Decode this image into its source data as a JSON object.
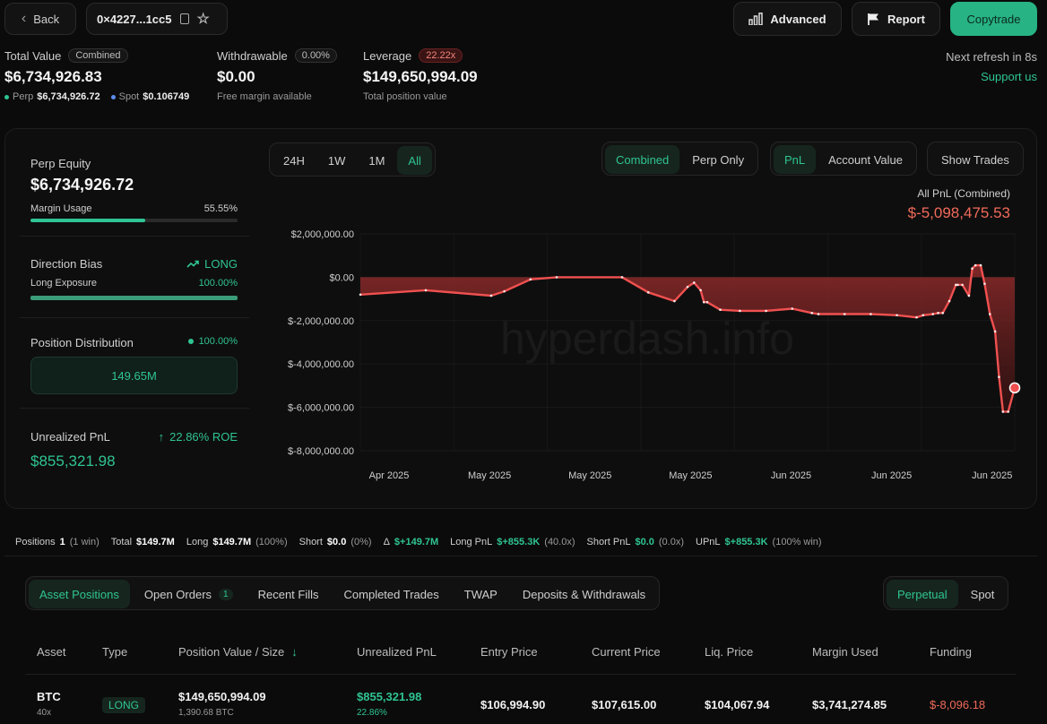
{
  "nav": {
    "back_label": "Back",
    "address": "0×4227...1cc5"
  },
  "actions": {
    "advanced": "Advanced",
    "report": "Report",
    "copytrade": "Copytrade"
  },
  "refresh": {
    "text": "Next refresh in 8s",
    "support": "Support us"
  },
  "summary": {
    "total_value_label": "Total Value",
    "total_value_badge": "Combined",
    "total_value": "$6,734,926.83",
    "perp_label": "Perp",
    "perp_value": "$6,734,926.72",
    "spot_label": "Spot",
    "spot_value": "$0.106749",
    "withdrawable_label": "Withdrawable",
    "withdrawable_badge": "0.00%",
    "withdrawable_value": "$0.00",
    "withdrawable_sub": "Free margin available",
    "leverage_label": "Leverage",
    "leverage_badge": "22.22x",
    "leverage_value": "$149,650,994.09",
    "leverage_sub": "Total position value"
  },
  "side": {
    "perp_equity_label": "Perp Equity",
    "perp_equity_value": "$6,734,926.72",
    "margin_usage_label": "Margin Usage",
    "margin_usage_value": "55.55%",
    "margin_usage_fraction": 0.5555,
    "direction_label": "Direction Bias",
    "direction_value": "LONG",
    "long_exposure_label": "Long Exposure",
    "long_exposure_value": "100.00%",
    "long_exposure_fraction": 1.0,
    "distribution_label": "Position Distribution",
    "distribution_value": "100.00%",
    "distribution_amount": "149.65M",
    "upnl_label": "Unrealized PnL",
    "upnl_roe": "22.86% ROE",
    "upnl_value": "$855,321.98"
  },
  "chart_controls": {
    "ranges": [
      "24H",
      "1W",
      "1M",
      "All"
    ],
    "active_range": "All",
    "modes": [
      "Combined",
      "Perp Only"
    ],
    "active_mode": "Combined",
    "metrics": [
      "PnL",
      "Account Value"
    ],
    "active_metric": "PnL",
    "show_trades": "Show Trades"
  },
  "chart_data": {
    "type": "area",
    "title": "All PnL (Combined)",
    "headline": "$-5,098,475.53",
    "watermark": "hyperdash.info",
    "x_tick_labels": [
      "Apr 2025",
      "May 2025",
      "May 2025",
      "May 2025",
      "Jun 2025",
      "Jun 2025",
      "Jun 2025"
    ],
    "y_tick_labels": [
      "$2,000,000.00",
      "$0.00",
      "$-2,000,000.00",
      "$-4,000,000.00",
      "$-6,000,000.00",
      "$-8,000,000.00"
    ],
    "y_ticks": [
      2000000,
      0,
      -2000000,
      -4000000,
      -6000000,
      -8000000
    ],
    "ylim": [
      -8000000,
      2000000
    ],
    "x_range": [
      0,
      100
    ],
    "series": [
      {
        "color": "#f05050",
        "x": [
          0,
          10,
          20,
          22,
          26,
          30,
          40,
          44,
          48,
          50,
          51,
          52,
          52.5,
          53,
          55,
          58,
          62,
          66,
          69,
          70,
          74,
          78,
          82,
          85,
          86,
          87.5,
          88.3,
          89,
          90,
          91,
          91.3,
          92,
          93,
          93.5,
          94,
          94.8,
          95.4,
          96.2,
          97,
          97.6,
          98.2,
          99,
          100
        ],
        "y": [
          -800000,
          -600000,
          -850000,
          -650000,
          -100000,
          0,
          0,
          -700000,
          -1100000,
          -450000,
          -250000,
          -600000,
          -1150000,
          -1150000,
          -1500000,
          -1550000,
          -1550000,
          -1450000,
          -1650000,
          -1700000,
          -1700000,
          -1700000,
          -1750000,
          -1850000,
          -1750000,
          -1700000,
          -1650000,
          -1650000,
          -1100000,
          -350000,
          -350000,
          -350000,
          -850000,
          400000,
          550000,
          550000,
          -300000,
          -1700000,
          -2500000,
          -4600000,
          -6200000,
          -6200000,
          -5100000
        ]
      }
    ]
  },
  "stats": {
    "positions_label": "Positions",
    "positions_count": "1",
    "positions_wins": "(1 win)",
    "total_label": "Total",
    "total_value": "$149.7M",
    "long_label": "Long",
    "long_value": "$149.7M",
    "long_pct": "(100%)",
    "short_label": "Short",
    "short_value": "$0.0",
    "short_pct": "(0%)",
    "delta_label": "Δ",
    "delta_value": "$+149.7M",
    "long_pnl_label": "Long PnL",
    "long_pnl_value": "$+855.3K",
    "long_pnl_mult": "(40.0x)",
    "short_pnl_label": "Short PnL",
    "short_pnl_value": "$0.0",
    "short_pnl_mult": "(0.0x)",
    "upnl_label": "UPnL",
    "upnl_value": "$+855.3K",
    "upnl_note": "(100% win)"
  },
  "tabs": {
    "items": [
      "Asset Positions",
      "Open Orders",
      "Recent Fills",
      "Completed Trades",
      "TWAP",
      "Deposits & Withdrawals"
    ],
    "open_orders_count": "1",
    "market": [
      "Perpetual",
      "Spot"
    ]
  },
  "table": {
    "headers": [
      "Asset",
      "Type",
      "Position Value / Size",
      "Unrealized PnL",
      "Entry Price",
      "Current Price",
      "Liq. Price",
      "Margin Used",
      "Funding"
    ],
    "row": {
      "asset": "BTC",
      "leverage": "40x",
      "type": "LONG",
      "position_value": "$149,650,994.09",
      "size": "1,390.68 BTC",
      "upnl": "$855,321.98",
      "upnl_pct": "22.86%",
      "entry": "$106,994.90",
      "current": "$107,615.00",
      "liq": "$104,067.94",
      "margin": "$3,741,274.85",
      "funding": "$-8,096.18"
    }
  }
}
